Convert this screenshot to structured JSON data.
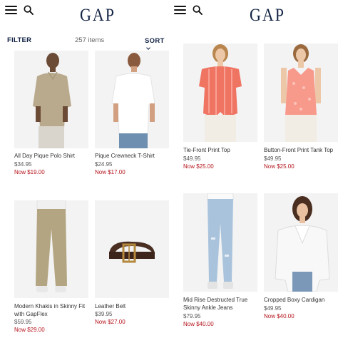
{
  "brand": {
    "logo_text": "GAP",
    "logo_color": "#122344",
    "sale_color": "#b4141c"
  },
  "left_screen": {
    "filter_label": "FILTER",
    "items_count": "257 items",
    "sort_label": "SORT",
    "products": [
      {
        "name": "All Day Pique Polo Shirt",
        "price": "$34.95",
        "sale": "Now $19.00"
      },
      {
        "name": "Pique Crewneck T-Shirt",
        "price": "$24.95",
        "sale": "Now $17.00"
      },
      {
        "name": "Modern Khakis in Skinny Fit with GapFlex",
        "price": "$59.95",
        "sale": "Now $29.00"
      },
      {
        "name": "Leather Belt",
        "price": "$39.95",
        "sale": "Now $27.00"
      }
    ]
  },
  "right_screen": {
    "products": [
      {
        "name": "Tie-Front Print Top",
        "price": "$49.95",
        "sale": "Now $25.00"
      },
      {
        "name": "Button-Front Print Tank Top",
        "price": "$49.95",
        "sale": "Now $25.00"
      },
      {
        "name": "Mid Rise Destructed True Skinny Ankle Jeans",
        "price": "$79.95",
        "sale": "Now $40.00"
      },
      {
        "name": "Cropped Boxy Cardigan",
        "price": "$49.95",
        "sale": "Now $40.00"
      }
    ]
  },
  "icons": {
    "menu": "hamburger-menu-icon",
    "search": "search-icon",
    "sort_chevron": "chevron-down-icon"
  }
}
